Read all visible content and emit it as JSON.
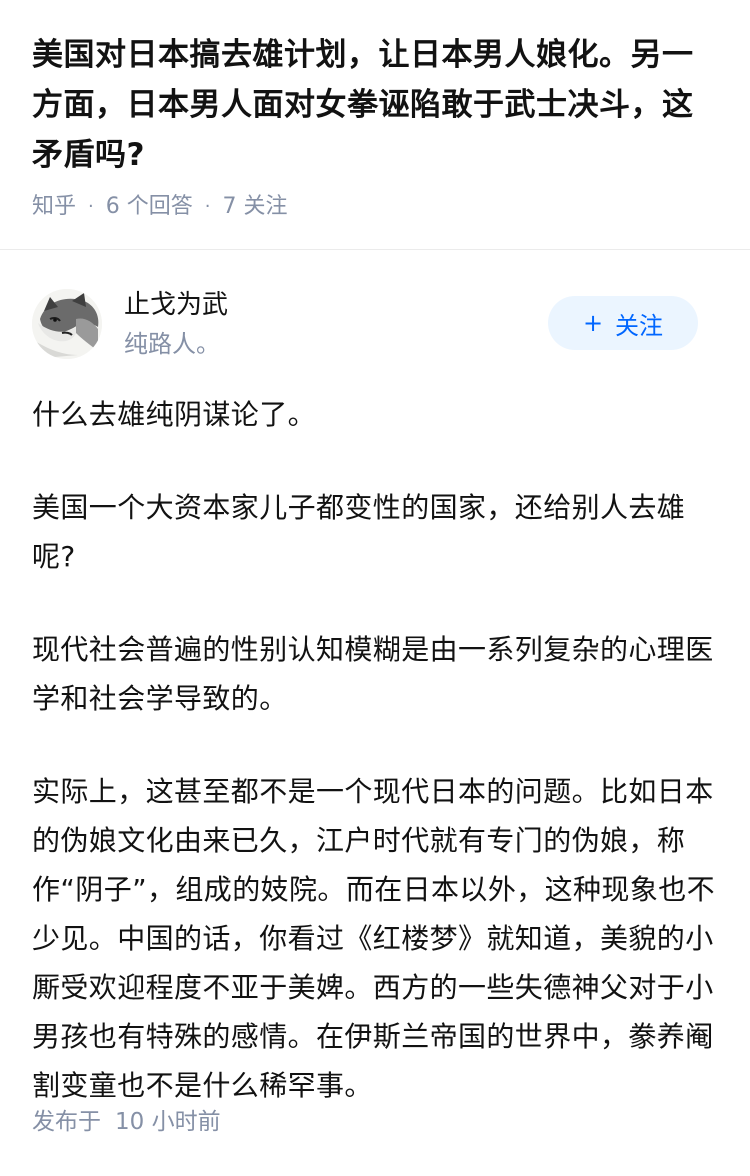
{
  "question": {
    "title": "美国对日本搞去雄计划，让日本男人娘化。另一方面，日本男人面对女拳诬陷敢于武士决斗，这矛盾吗?",
    "site": "知乎",
    "answer_count": "6 个回答",
    "follow_count": "7 关注"
  },
  "answer": {
    "author": {
      "name": "止戈为武",
      "bio": "纯路人。",
      "avatar_icon": "wolf-avatar-icon"
    },
    "follow_button": {
      "plus": "+",
      "label": "关注"
    },
    "paragraphs": [
      "什么去雄纯阴谋论了。",
      "美国一个大资本家儿子都变性的国家，还给别人去雄呢?",
      "现代社会普遍的性别认知模糊是由一系列复杂的心理医学和社会学导致的。",
      "实际上，这甚至都不是一个现代日本的问题。比如日本的伪娘文化由来已久，江户时代就有专门的伪娘，称作“阴子”，组成的妓院。而在日本以外，这种现象也不少见。中国的话，你看过《红楼梦》就知道，美貌的小厮受欢迎程度不亚于美婢。西方的一些失德神父对于小男孩也有特殊的感情。在伊斯兰帝国的世界中，豢养阉割变童也不是什么稀罕事。"
    ],
    "publish_label": "发布于",
    "publish_time": "10 小时前"
  },
  "colors": {
    "text": "#121212",
    "muted": "#8590a6",
    "accent": "#0066ff",
    "button_bg": "#ebf5ff"
  }
}
